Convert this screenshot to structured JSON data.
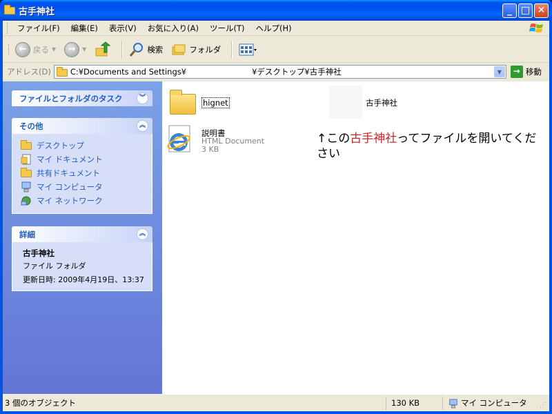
{
  "window": {
    "title": "古手神社",
    "buttons": [
      "minimize",
      "maximize",
      "close"
    ]
  },
  "menubar": {
    "items": [
      "ファイル(F)",
      "編集(E)",
      "表示(V)",
      "お気に入り(A)",
      "ツール(T)",
      "ヘルプ(H)"
    ]
  },
  "toolbar": {
    "back_label": "戻る",
    "search_label": "検索",
    "folders_label": "フォルダ"
  },
  "address": {
    "label": "アドレス(D)",
    "value": "C:¥Documents and Settings¥                          ¥デスクトップ¥古手神社",
    "go_label": "移動"
  },
  "taskpane": {
    "file_tasks": {
      "title": "ファイルとフォルダのタスク"
    },
    "other_places": {
      "title": "その他",
      "links": [
        {
          "label": "デスクトップ",
          "icon": "folder-icon"
        },
        {
          "label": "マイ ドキュメント",
          "icon": "documents-icon"
        },
        {
          "label": "共有ドキュメント",
          "icon": "folder-icon"
        },
        {
          "label": "マイ コンピュータ",
          "icon": "computer-icon"
        },
        {
          "label": "マイ ネットワーク",
          "icon": "network-icon"
        }
      ]
    },
    "details": {
      "title": "詳細",
      "name": "古手神社",
      "type": "ファイル フォルダ",
      "modified": "更新日時: 2009年4月19日、13:37"
    }
  },
  "content": {
    "items": [
      {
        "name": "hignet",
        "kind": "folder"
      },
      {
        "name": "古手神社",
        "kind": "blank"
      },
      {
        "name": "説明書",
        "type": "HTML Document",
        "size": "3 KB",
        "kind": "html"
      }
    ],
    "annotation": {
      "prefix": "↑この",
      "highlight": "古手神社",
      "suffix": "ってファイルを開いてください",
      "highlight_color": "#c8282a"
    }
  },
  "statusbar": {
    "count": "3 個のオブジェクト",
    "size": "130 KB",
    "location": "マイ コンピュータ"
  },
  "colors": {
    "titlebar": "#0054e3",
    "taskpane_link": "#215dc6"
  }
}
